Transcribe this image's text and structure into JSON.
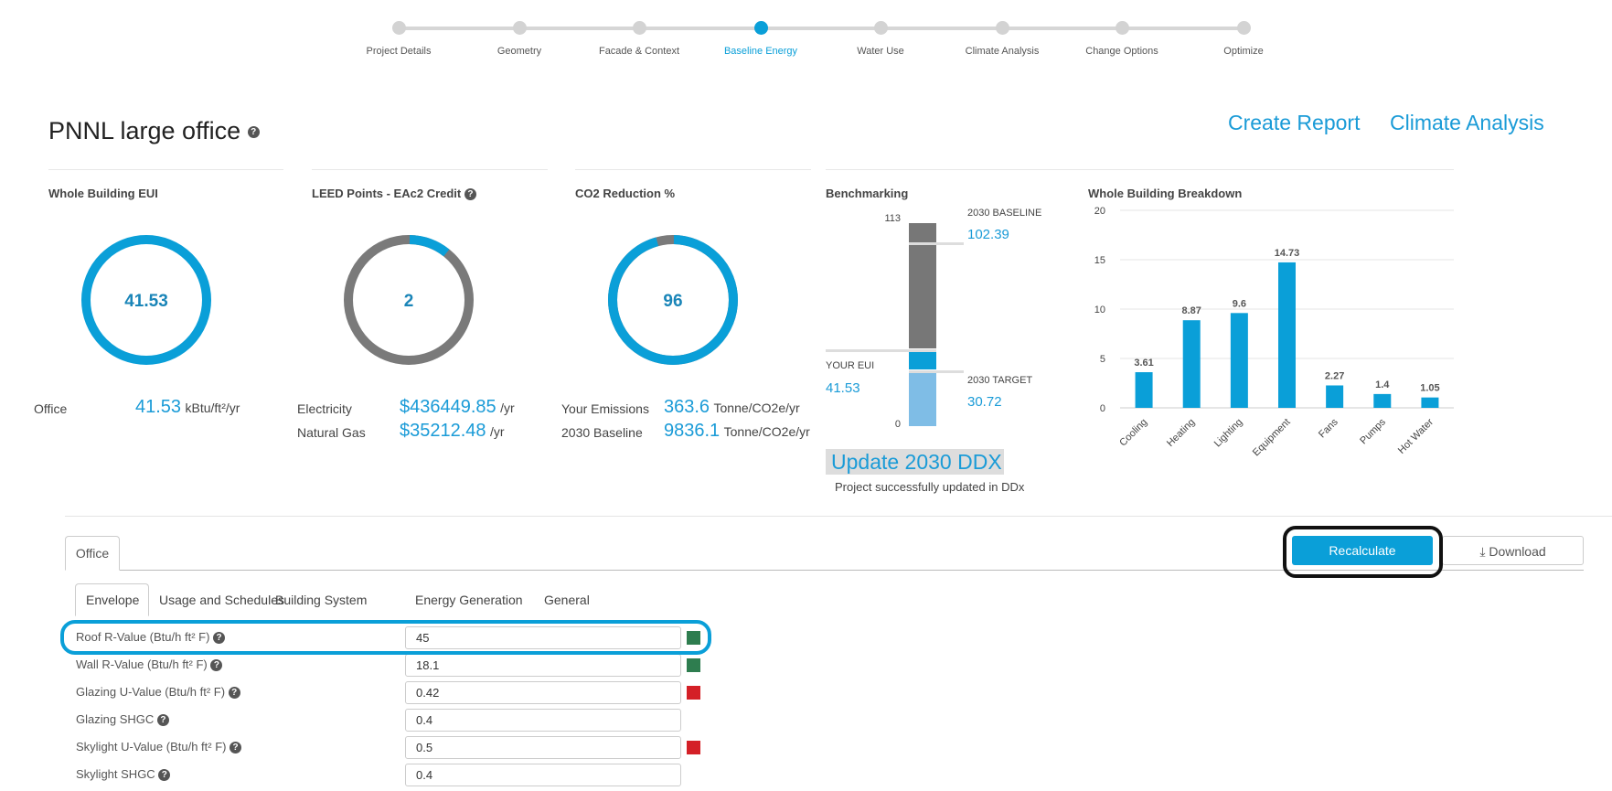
{
  "stepper": {
    "steps": [
      "Project Details",
      "Geometry",
      "Facade & Context",
      "Baseline Energy",
      "Water Use",
      "Climate Analysis",
      "Change Options",
      "Optimize"
    ],
    "active_index": 3
  },
  "header": {
    "title": "PNNL large office",
    "help_icon": "question-circle-icon",
    "links": [
      "Create Report",
      "Climate Analysis"
    ]
  },
  "cards": {
    "eui": {
      "title": "Whole Building EUI",
      "value": "41.53",
      "rows": [
        {
          "label": "Office",
          "value": "41.53",
          "unit": "kBtu/ft²/yr"
        }
      ]
    },
    "leed": {
      "title": "LEED Points - EAc2 Credit",
      "value": "2",
      "fraction": 0.11,
      "rows": [
        {
          "label": "Electricity",
          "value": "$436449.85",
          "unit": "/yr"
        },
        {
          "label": "Natural Gas",
          "value": "$35212.48",
          "unit": "/yr"
        }
      ]
    },
    "co2": {
      "title": "CO2 Reduction %",
      "value": "96",
      "fraction": 0.96,
      "rows": [
        {
          "label": "Your Emissions",
          "value": "363.6",
          "unit": "Tonne/CO2e/yr"
        },
        {
          "label": "2030 Baseline",
          "value": "9836.1",
          "unit": "Tonne/CO2e/yr"
        }
      ]
    }
  },
  "benchmark": {
    "title": "Benchmarking",
    "max_label": "113",
    "min_label": "0",
    "max": 113,
    "baseline_label": "2030 BASELINE",
    "baseline_value": "102.39",
    "baseline": 102.39,
    "your_label": "YOUR EUI",
    "your_value": "41.53",
    "your": 41.53,
    "target_label": "2030 TARGET",
    "target_value": "30.72",
    "target": 30.72,
    "update_button": "Update 2030 DDX",
    "message": "Project successfully updated in DDx",
    "colors": {
      "baseline": "#777777",
      "your": "#0a9fd8",
      "target": "#7fbde6"
    }
  },
  "chart_data": {
    "type": "bar",
    "title": "Whole Building Breakdown",
    "categories": [
      "Cooling",
      "Heating",
      "Lighting",
      "Equipment",
      "Fans",
      "Pumps",
      "Hot Water"
    ],
    "values": [
      3.61,
      8.87,
      9.6,
      14.73,
      2.27,
      1.4,
      1.05
    ],
    "value_labels": [
      "3.61",
      "8.87",
      "9.6",
      "14.73",
      "2.27",
      "1.4",
      "1.05"
    ],
    "ylim": [
      0,
      20
    ],
    "yticks": [
      "0",
      "5",
      "10",
      "15",
      "20"
    ],
    "grid": true,
    "color": "#0a9fd8"
  },
  "tabs": {
    "space_tab": "Office",
    "inner_tabs": [
      "Envelope",
      "Usage and Schedules",
      "Building System",
      "Energy Generation",
      "General"
    ],
    "active_inner": 0
  },
  "actions": {
    "recalculate": "Recalculate",
    "download": "Download"
  },
  "form": {
    "rows": [
      {
        "label": "Roof R-Value (Btu/h ft² F)",
        "value": "45",
        "indicator": "#2e7d4f",
        "help": true
      },
      {
        "label": "Wall R-Value (Btu/h ft² F)",
        "value": "18.1",
        "indicator": "#2e7d4f",
        "help": true
      },
      {
        "label": "Glazing U-Value (Btu/h ft² F)",
        "value": "0.42",
        "indicator": "#d42027",
        "help": true
      },
      {
        "label": "Glazing SHGC",
        "value": "0.4",
        "indicator": null,
        "help": true
      },
      {
        "label": "Skylight U-Value (Btu/h ft² F)",
        "value": "0.5",
        "indicator": "#d42027",
        "help": true
      },
      {
        "label": "Skylight SHGC",
        "value": "0.4",
        "indicator": null,
        "help": true
      }
    ]
  }
}
